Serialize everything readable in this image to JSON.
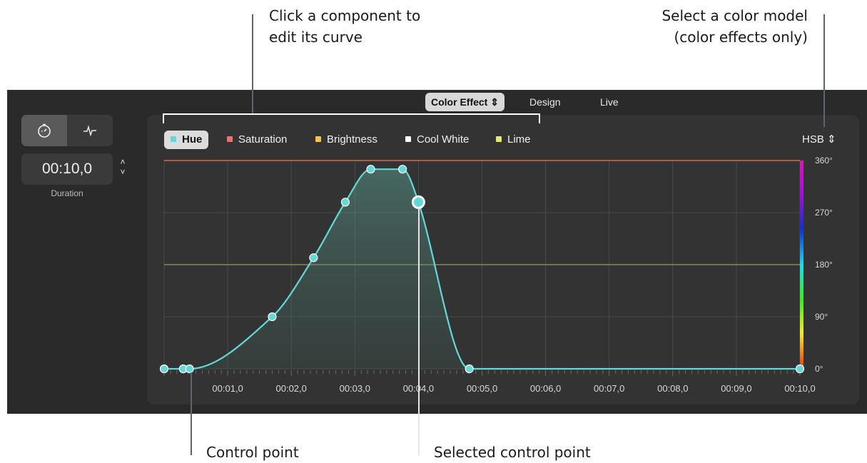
{
  "callouts": {
    "component": "Click a component to\nedit its curve",
    "color_model": "Select a color model\n(color effects only)",
    "control_point": "Control point",
    "selected_point": "Selected control point"
  },
  "topbar": {
    "tabs": [
      {
        "label": "Color Effect ⇕",
        "active": true
      },
      {
        "label": "Design",
        "active": false
      },
      {
        "label": "Live",
        "active": false
      }
    ]
  },
  "left_panel": {
    "timer_icon": "stopwatch-icon",
    "pulse_icon": "waveform-icon",
    "duration_value": "00:10,0",
    "duration_label": "Duration",
    "stepper_up": "˄",
    "stepper_down": "˅"
  },
  "legend": [
    {
      "label": "Hue",
      "color": "#62d9d8",
      "active": true
    },
    {
      "label": "Saturation",
      "color": "#f07070",
      "active": false
    },
    {
      "label": "Brightness",
      "color": "#f2c54a",
      "active": false
    },
    {
      "label": "Cool White",
      "color": "#ffffff",
      "active": false
    },
    {
      "label": "Lime",
      "color": "#e6ea6e",
      "active": false
    }
  ],
  "color_model": {
    "label": "HSB ⇕"
  },
  "chart_data": {
    "type": "line",
    "x_ticks": [
      "00:01,0",
      "00:02,0",
      "00:03,0",
      "00:04,0",
      "00:05,0",
      "00:06,0",
      "00:07,0",
      "00:08,0",
      "00:09,0",
      "00:10,0"
    ],
    "y_ticks": [
      "0°",
      "90°",
      "180°",
      "270°",
      "360°"
    ],
    "xlim": [
      0,
      10
    ],
    "ylim": [
      0,
      360
    ],
    "series": [
      {
        "name": "Hue",
        "color": "#62d9d8",
        "points": [
          [
            0,
            0
          ],
          [
            0.3,
            0
          ],
          [
            0.4,
            0
          ],
          [
            1.7,
            90
          ],
          [
            2.35,
            192
          ],
          [
            2.85,
            288
          ],
          [
            3.25,
            345
          ],
          [
            3.75,
            345
          ],
          [
            4.0,
            288
          ],
          [
            4.8,
            0
          ],
          [
            10,
            0
          ]
        ],
        "selected_index": 8
      },
      {
        "name": "Saturation",
        "color": "#d9694e",
        "points": [
          [
            0,
            360
          ],
          [
            10,
            360
          ]
        ]
      },
      {
        "name": "Lime",
        "color": "#8a8a55",
        "points": [
          [
            0,
            180
          ],
          [
            10,
            180
          ]
        ]
      }
    ]
  },
  "colors": {
    "accent": "#62d9d8",
    "panel": "#333333",
    "app": "#2a2a2a"
  }
}
